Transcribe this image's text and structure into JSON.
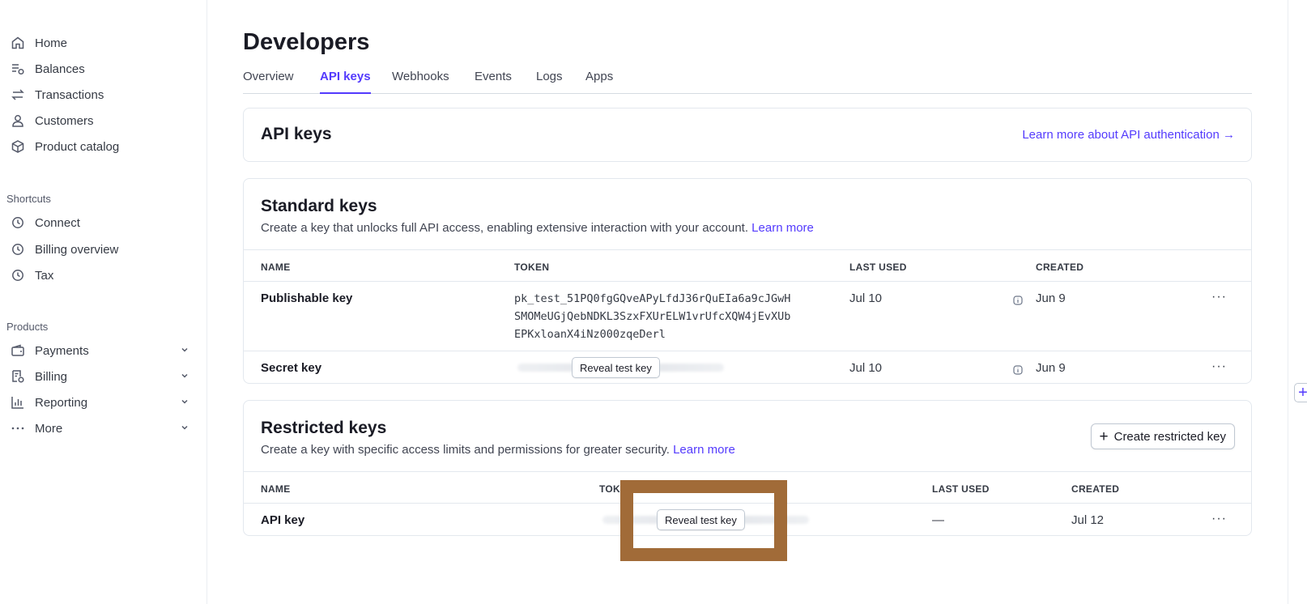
{
  "sidebar": {
    "main_items": [
      {
        "label": "Home",
        "icon": "home-icon"
      },
      {
        "label": "Balances",
        "icon": "balances-icon"
      },
      {
        "label": "Transactions",
        "icon": "transactions-icon"
      },
      {
        "label": "Customers",
        "icon": "customer-icon"
      },
      {
        "label": "Product catalog",
        "icon": "box-icon"
      }
    ],
    "shortcuts_label": "Shortcuts",
    "shortcuts": [
      {
        "label": "Connect",
        "icon": "clock-icon"
      },
      {
        "label": "Billing overview",
        "icon": "clock-icon"
      },
      {
        "label": "Tax",
        "icon": "clock-icon"
      }
    ],
    "products_label": "Products",
    "products": [
      {
        "label": "Payments",
        "icon": "wallet-icon"
      },
      {
        "label": "Billing",
        "icon": "receipt-icon"
      },
      {
        "label": "Reporting",
        "icon": "bar-chart-icon"
      },
      {
        "label": "More",
        "icon": "ellipsis-icon"
      }
    ]
  },
  "header": {
    "title": "Developers",
    "tabs": [
      "Overview",
      "API keys",
      "Webhooks",
      "Events",
      "Logs",
      "Apps"
    ],
    "active_tab": "API keys"
  },
  "api_keys_card": {
    "title": "API keys",
    "link": "Learn more about API authentication →"
  },
  "standard_keys": {
    "title": "Standard keys",
    "description": "Create a key that unlocks full API access, enabling extensive interaction with your account.",
    "learn_more": "Learn more",
    "columns": [
      "NAME",
      "TOKEN",
      "LAST USED",
      "CREATED"
    ],
    "rows": [
      {
        "name": "Publishable key",
        "token_lines": [
          "pk_test_51PQ0fgGQveAPyLfdJ36rQuEIa6a9cJGwH",
          "SMOMeUGjQebNDKL3SzxFXUrELW1vrUfcXQW4jEvXUb",
          "EPKxloanX4iNz000zqeDerl"
        ],
        "last_used": "Jul 10",
        "created": "Jun 9"
      },
      {
        "name": "Secret key",
        "reveal_label": "Reveal test key",
        "last_used": "Jul 10",
        "created": "Jun 9"
      }
    ]
  },
  "restricted_keys": {
    "title": "Restricted keys",
    "description": "Create a key with specific access limits and permissions for greater security.",
    "learn_more": "Learn more",
    "create_button": "Create restricted key",
    "columns": [
      "NAME",
      "TOKEN",
      "LAST USED",
      "CREATED"
    ],
    "rows": [
      {
        "name": "API key",
        "reveal_label": "Reveal test key",
        "last_used": "—",
        "created": "Jul 12"
      }
    ]
  },
  "more_glyph": "···",
  "colors": {
    "accent": "#533afd",
    "highlight_box": "#a16b38"
  }
}
